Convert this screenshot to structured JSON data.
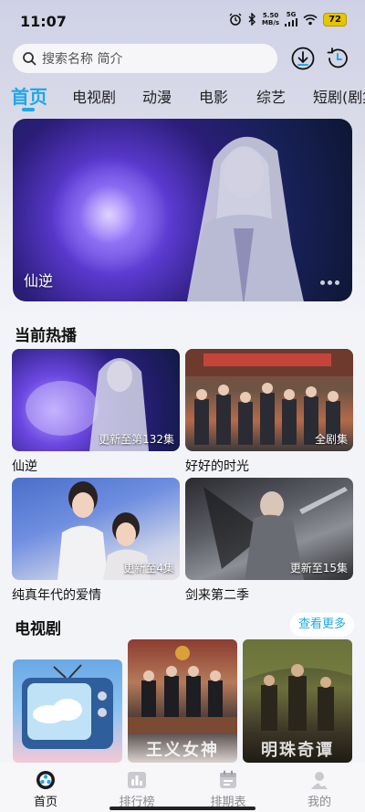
{
  "status_bar": {
    "time": "11:07",
    "speed_value": "5.50",
    "speed_unit": "MB/s",
    "network": "5G",
    "battery": "72"
  },
  "search": {
    "placeholder": "搜索名称 简介"
  },
  "tabs": [
    {
      "label": "首页",
      "active": true
    },
    {
      "label": "电视剧",
      "active": false
    },
    {
      "label": "动漫",
      "active": false
    },
    {
      "label": "电影",
      "active": false
    },
    {
      "label": "综艺",
      "active": false
    },
    {
      "label": "短剧(剧集",
      "active": false
    }
  ],
  "banner": {
    "title": "仙逆"
  },
  "now_playing": {
    "title": "当前热播",
    "items": [
      {
        "title": "仙逆",
        "badge": "更新至第132集"
      },
      {
        "title": "好好的时光",
        "badge": "全剧集"
      },
      {
        "title": "纯真年代的爱情",
        "badge": "更新至4集"
      },
      {
        "title": "剑来第二季",
        "badge": "更新至15集"
      }
    ]
  },
  "tv_section": {
    "title": "电视剧",
    "see_more": "查看更多",
    "poster_captions": [
      "",
      "王义女神",
      "明珠奇谭"
    ]
  },
  "bottom_nav": [
    {
      "label": "首页",
      "icon": "home-icon",
      "active": true
    },
    {
      "label": "排行榜",
      "icon": "ranking-icon",
      "active": false
    },
    {
      "label": "排期表",
      "icon": "calendar-icon",
      "active": false
    },
    {
      "label": "我的",
      "icon": "profile-icon",
      "active": false
    }
  ],
  "colors": {
    "accent": "#1fa8e8",
    "background": "#f3f4f8"
  }
}
